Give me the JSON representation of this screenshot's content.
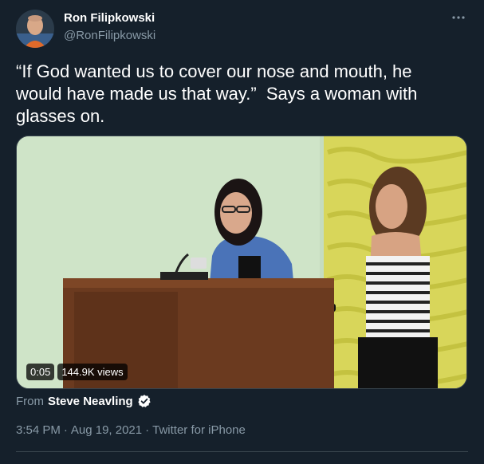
{
  "author": {
    "name": "Ron Filipkowski",
    "handle": "@RonFilipkowski"
  },
  "tweet": {
    "text": "“If God wanted us to cover our nose and mouth, he would have made us that way.”  Says a woman with glasses on."
  },
  "media": {
    "duration": "0:05",
    "views": "144.9K views"
  },
  "source": {
    "prefix": "From",
    "name": "Steve Neavling"
  },
  "meta": {
    "time": "3:54 PM",
    "separator1": "·",
    "date": "Aug 19, 2021",
    "separator2": "·",
    "client": "Twitter for iPhone"
  },
  "colors": {
    "background": "#15202b",
    "secondary_text": "#8899a6",
    "verified": "#1da1f2",
    "divider": "#38444d"
  },
  "icons": {
    "more": "more-dots-icon",
    "verified": "verified-badge-icon"
  }
}
